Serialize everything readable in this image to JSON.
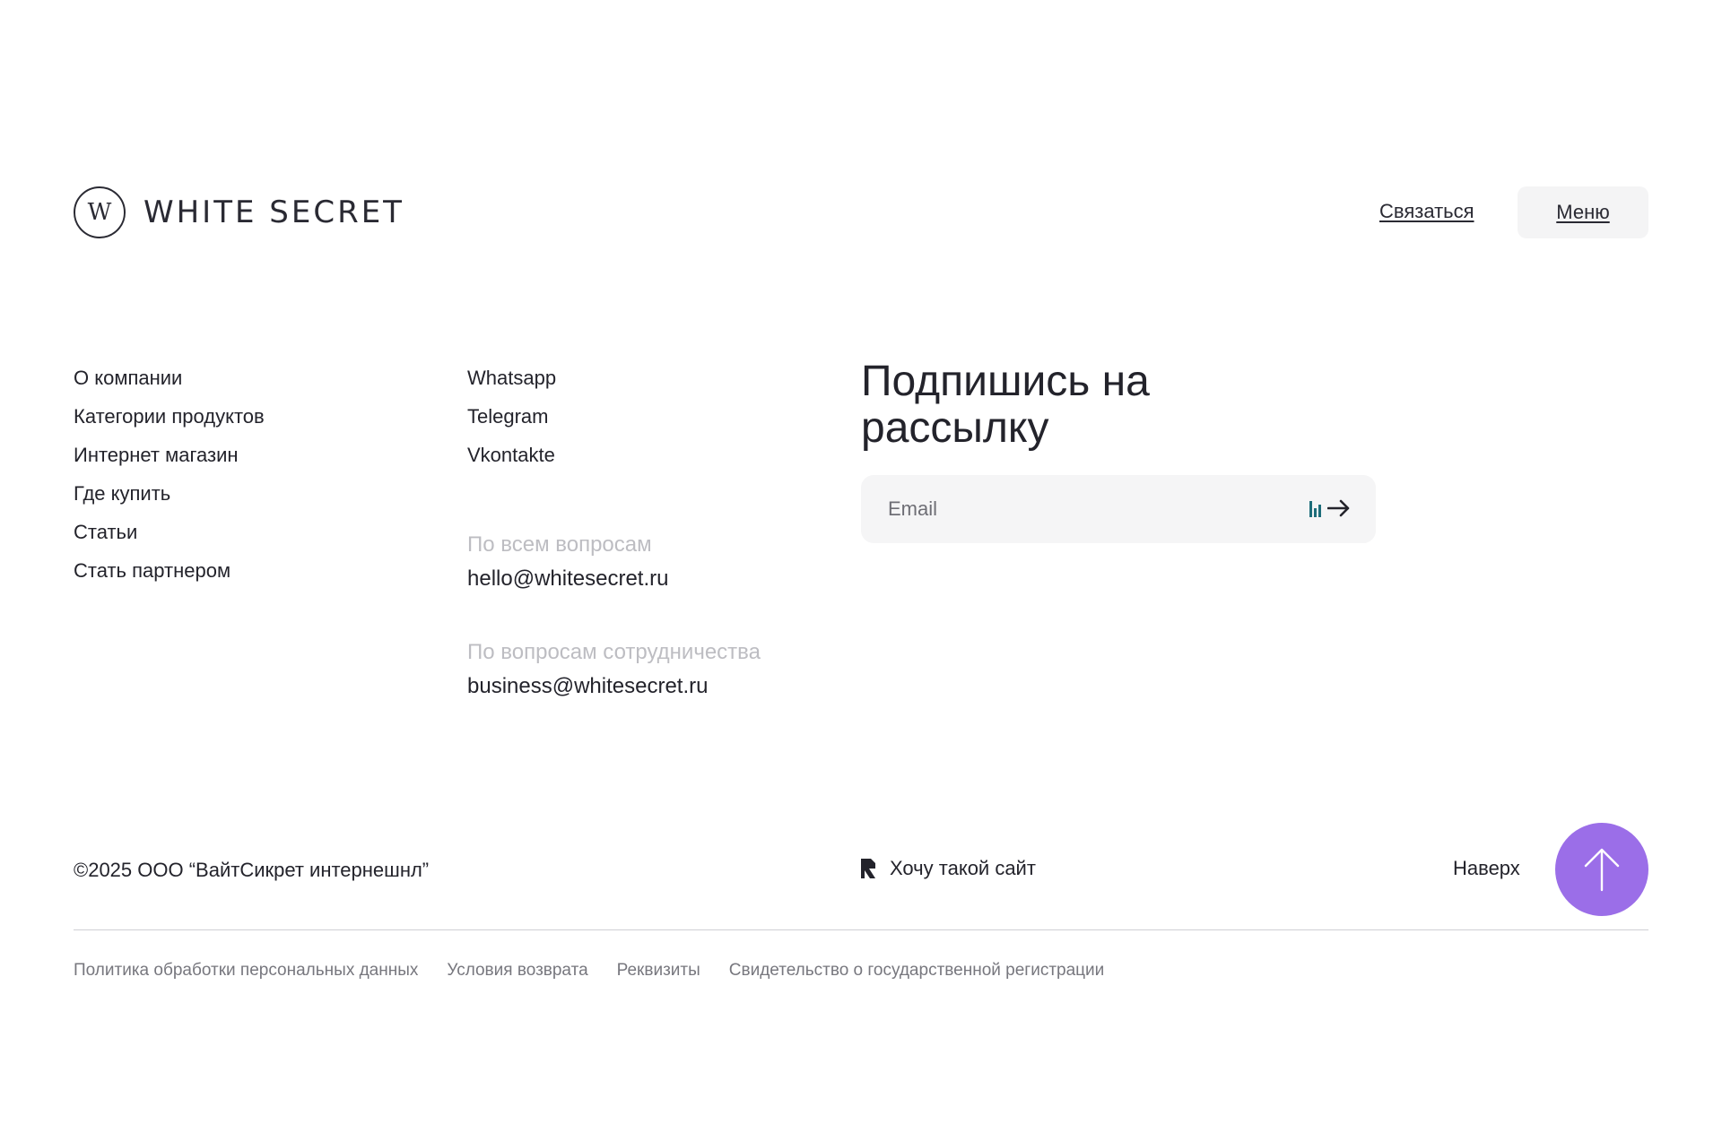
{
  "header": {
    "logo_letter": "W",
    "logo_text": "WHITE SECRET",
    "contact_label": "Связаться",
    "menu_label": "Меню"
  },
  "nav": {
    "items": [
      {
        "label": "О компании"
      },
      {
        "label": "Категории продуктов"
      },
      {
        "label": "Интернет магазин"
      },
      {
        "label": "Где купить"
      },
      {
        "label": "Статьи"
      },
      {
        "label": "Стать партнером"
      }
    ]
  },
  "social": {
    "items": [
      {
        "label": "Whatsapp"
      },
      {
        "label": "Telegram"
      },
      {
        "label": "Vkontakte"
      }
    ]
  },
  "contacts": [
    {
      "label": "По всем вопросам",
      "email": "hello@whitesecret.ru"
    },
    {
      "label": "По вопросам сотрудничества",
      "email": "business@whitesecret.ru"
    }
  ],
  "subscribe": {
    "title": "Подпишись на рассылку",
    "email_placeholder": "Email",
    "email_value": ""
  },
  "footer": {
    "copyright": "©2025 ООО “ВайтСикрет интернешнл”",
    "made_by_label": "Хочу такой сайт",
    "to_top_label": "Наверх",
    "accent_color": "#9b6ee8"
  },
  "legal": {
    "links": [
      {
        "label": "Политика обработки персональных данных"
      },
      {
        "label": "Условия возврата"
      },
      {
        "label": "Реквизиты"
      },
      {
        "label": "Свидетельство о государственной регистрации"
      }
    ]
  }
}
